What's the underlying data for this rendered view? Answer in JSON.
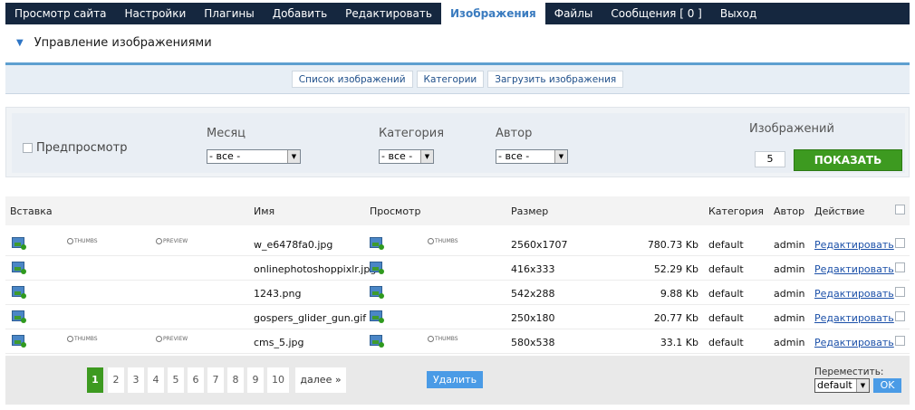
{
  "nav": {
    "items": [
      "Просмотр сайта",
      "Настройки",
      "Плагины",
      "Добавить",
      "Редактировать",
      "Изображения",
      "Файлы",
      "Сообщения  [ 0 ]",
      "Выход"
    ],
    "active_index": 5
  },
  "page": {
    "title": "Управление изображениями"
  },
  "subtabs": [
    "Список изображений",
    "Категории",
    "Загрузить изображения"
  ],
  "filters": {
    "preview_label": "Предпросмотр",
    "month_label": "Месяц",
    "month_value": "- все -",
    "category_label": "Категория",
    "category_value": "- все -",
    "author_label": "Автор",
    "author_value": "- все -",
    "count_label": "Изображений",
    "count_value": "5",
    "show_button": "ПОКАЗАТЬ"
  },
  "table": {
    "headers": {
      "insert": "Вставка",
      "name": "Имя",
      "preview": "Просмотр",
      "size": "Размер",
      "category": "Категория",
      "author": "Автор",
      "action": "Действие"
    },
    "thumbs_label": "THUMBS",
    "preview_label": "PREVIEW",
    "rows": [
      {
        "name": "w_e6478fa0.jpg",
        "dimensions": "2560x1707",
        "filesize": "780.73 Kb",
        "category": "default",
        "author": "admin",
        "action": "Редактировать"
      },
      {
        "name": "onlinephotoshoppixlr.jpg",
        "dimensions": "416x333",
        "filesize": "52.29 Kb",
        "category": "default",
        "author": "admin",
        "action": "Редактировать"
      },
      {
        "name": "1243.png",
        "dimensions": "542x288",
        "filesize": "9.88 Kb",
        "category": "default",
        "author": "admin",
        "action": "Редактировать"
      },
      {
        "name": "gospers_glider_gun.gif",
        "dimensions": "250x180",
        "filesize": "20.77 Kb",
        "category": "default",
        "author": "admin",
        "action": "Редактировать"
      },
      {
        "name": "cms_5.jpg",
        "dimensions": "580x538",
        "filesize": "33.1 Kb",
        "category": "default",
        "author": "admin",
        "action": "Редактировать"
      }
    ]
  },
  "pagination": {
    "pages": [
      "1",
      "2",
      "3",
      "4",
      "5",
      "6",
      "7",
      "8",
      "9",
      "10"
    ],
    "current": "1",
    "next_label": "далее »"
  },
  "footer": {
    "delete_button": "Удалить",
    "move_label": "Переместить:",
    "move_value": "default",
    "ok_button": "OK"
  },
  "colors": {
    "nav_bg": "#15273f",
    "accent_blue": "#5e9fd0",
    "green_button": "#3d9a20",
    "blue_button": "#4a9be6",
    "link": "#1a4fa8"
  }
}
